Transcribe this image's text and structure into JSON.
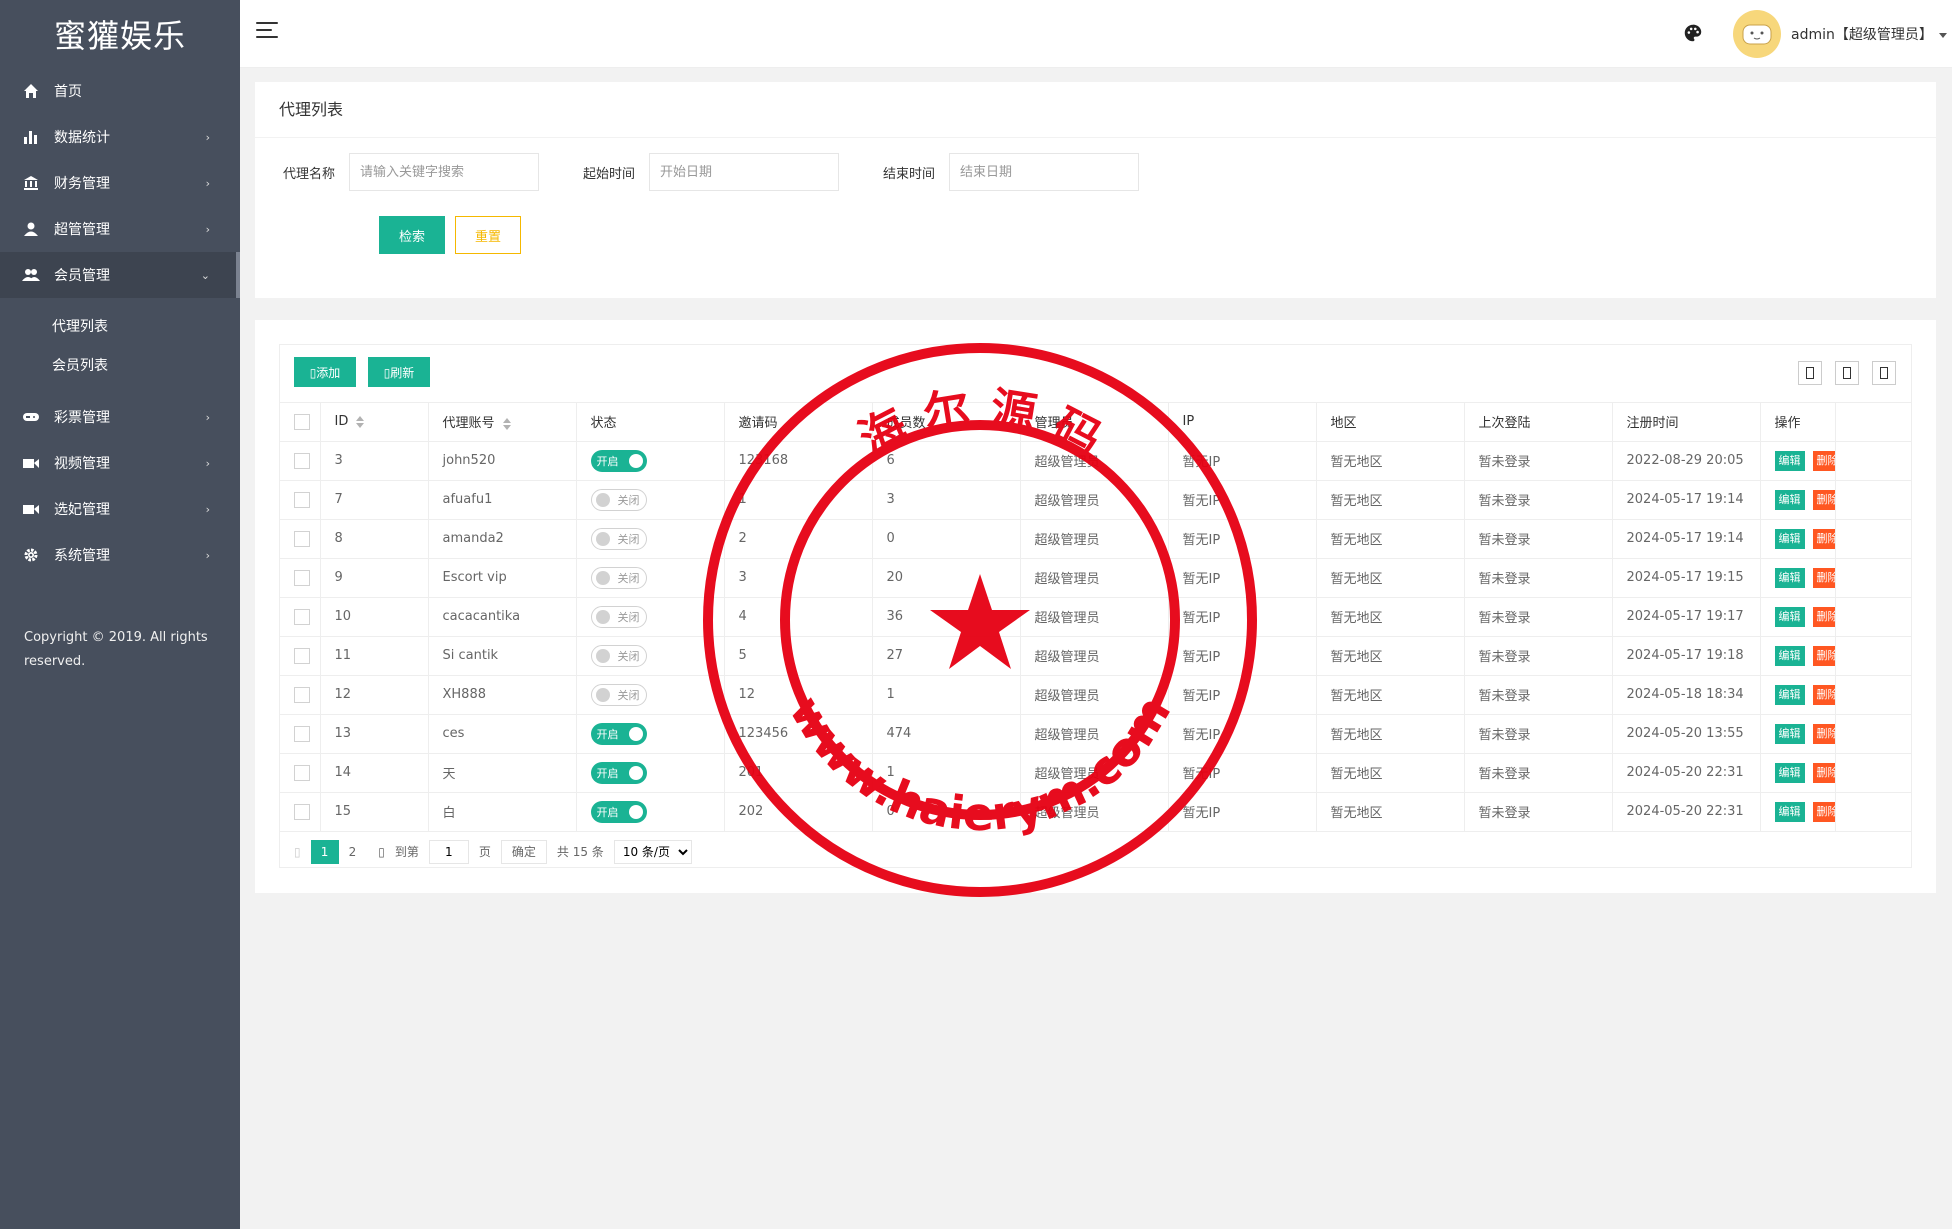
{
  "brand": "蜜獾娱乐",
  "sidebar": {
    "items": [
      {
        "label": "首页",
        "icon": "home-icon",
        "arrow": ""
      },
      {
        "label": "数据统计",
        "icon": "bar-chart-icon",
        "arrow": "›"
      },
      {
        "label": "财务管理",
        "icon": "bank-icon",
        "arrow": "›"
      },
      {
        "label": "超管管理",
        "icon": "user-icon",
        "arrow": "›"
      },
      {
        "label": "会员管理",
        "icon": "users-icon",
        "arrow": "⌄"
      },
      {
        "label": "彩票管理",
        "icon": "gamepad-icon",
        "arrow": "›"
      },
      {
        "label": "视频管理",
        "icon": "video-icon",
        "arrow": "›"
      },
      {
        "label": "选妃管理",
        "icon": "camera-icon",
        "arrow": "›"
      },
      {
        "label": "系统管理",
        "icon": "gear-icon",
        "arrow": "›"
      }
    ],
    "sub_items": [
      "代理列表",
      "会员列表"
    ],
    "copyright": "Copyright © 2019. All rights reserved."
  },
  "header": {
    "user": "admin【超级管理员】"
  },
  "search": {
    "title": "代理列表",
    "name_label": "代理名称",
    "name_placeholder": "请输入关键字搜索",
    "start_label": "起始时间",
    "start_placeholder": "开始日期",
    "end_label": "结束时间",
    "end_placeholder": "结束日期",
    "search_btn": "检索",
    "reset_btn": "重置"
  },
  "toolbar": {
    "add": "▯添加",
    "refresh": "▯刷新"
  },
  "table": {
    "columns": [
      "ID",
      "代理账号",
      "状态",
      "邀请码",
      "成员数",
      "管理员",
      "IP",
      "地区",
      "上次登陆",
      "注册时间",
      "操作"
    ],
    "edit_label": "编辑",
    "delete_label": "删除",
    "on_label": "开启",
    "off_label": "关闭",
    "rows": [
      {
        "id": "3",
        "account": "john520",
        "status": "on",
        "code": "123168",
        "members": "6",
        "admin": "超级管理员",
        "ip": "暂无IP",
        "region": "暂无地区",
        "last": "暂未登录",
        "reg": "2022-08-29 20:05"
      },
      {
        "id": "7",
        "account": "afuafu1",
        "status": "off",
        "code": "1",
        "members": "3",
        "admin": "超级管理员",
        "ip": "暂无IP",
        "region": "暂无地区",
        "last": "暂未登录",
        "reg": "2024-05-17 19:14"
      },
      {
        "id": "8",
        "account": "amanda2",
        "status": "off",
        "code": "2",
        "members": "0",
        "admin": "超级管理员",
        "ip": "暂无IP",
        "region": "暂无地区",
        "last": "暂未登录",
        "reg": "2024-05-17 19:14"
      },
      {
        "id": "9",
        "account": "Escort vip",
        "status": "off",
        "code": "3",
        "members": "20",
        "admin": "超级管理员",
        "ip": "暂无IP",
        "region": "暂无地区",
        "last": "暂未登录",
        "reg": "2024-05-17 19:15"
      },
      {
        "id": "10",
        "account": "cacacantika",
        "status": "off",
        "code": "4",
        "members": "36",
        "admin": "超级管理员",
        "ip": "暂无IP",
        "region": "暂无地区",
        "last": "暂未登录",
        "reg": "2024-05-17 19:17"
      },
      {
        "id": "11",
        "account": "Si cantik",
        "status": "off",
        "code": "5",
        "members": "27",
        "admin": "超级管理员",
        "ip": "暂无IP",
        "region": "暂无地区",
        "last": "暂未登录",
        "reg": "2024-05-17 19:18"
      },
      {
        "id": "12",
        "account": "XH888",
        "status": "off",
        "code": "12",
        "members": "1",
        "admin": "超级管理员",
        "ip": "暂无IP",
        "region": "暂无地区",
        "last": "暂未登录",
        "reg": "2024-05-18 18:34"
      },
      {
        "id": "13",
        "account": "ces",
        "status": "on",
        "code": "123456",
        "members": "474",
        "admin": "超级管理员",
        "ip": "暂无IP",
        "region": "暂无地区",
        "last": "暂未登录",
        "reg": "2024-05-20 13:55"
      },
      {
        "id": "14",
        "account": "天",
        "status": "on",
        "code": "201",
        "members": "1",
        "admin": "超级管理员",
        "ip": "暂无IP",
        "region": "暂无地区",
        "last": "暂未登录",
        "reg": "2024-05-20 22:31"
      },
      {
        "id": "15",
        "account": "白",
        "status": "on",
        "code": "202",
        "members": "0",
        "admin": "超级管理员",
        "ip": "暂无IP",
        "region": "暂无地区",
        "last": "暂未登录",
        "reg": "2024-05-20 22:31"
      }
    ]
  },
  "pager": {
    "current": "1",
    "next": "2",
    "goto_label": "到第",
    "goto_value": "1",
    "page_label": "页",
    "confirm": "确定",
    "total": "共 15 条",
    "size": "10 条/页"
  },
  "watermark": {
    "top_text": "海 尔 源 码",
    "bottom_text": "www.haierym.com",
    "color": "#e60012"
  }
}
